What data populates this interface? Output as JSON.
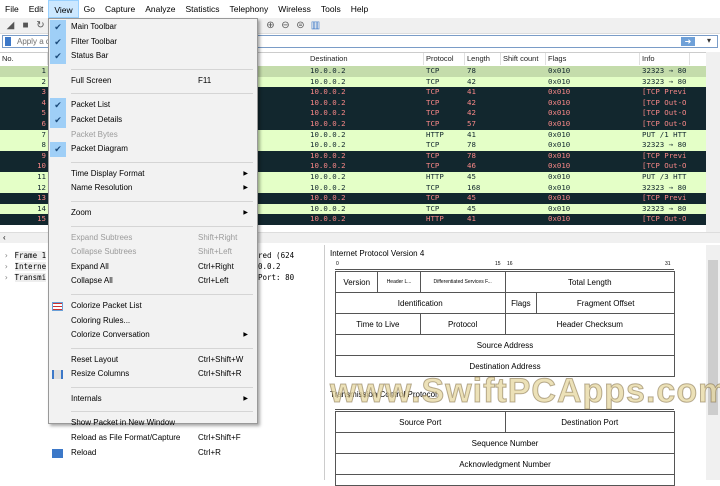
{
  "menubar": [
    "File",
    "Edit",
    "View",
    "Go",
    "Capture",
    "Analyze",
    "Statistics",
    "Telephony",
    "Wireless",
    "Tools",
    "Help"
  ],
  "filter": {
    "placeholder": "Apply a display filter ... <Ctrl-/>",
    "visible_text": "Apply a di"
  },
  "columns": {
    "no": "No.",
    "destination": "Destination",
    "protocol": "Protocol",
    "length": "Length",
    "shift": "Shift count",
    "flags": "Flags",
    "info": "Info"
  },
  "packets": [
    {
      "no": "1",
      "dst": "10.0.0.2",
      "proto": "TCP",
      "len": "78",
      "flags": "0x010",
      "info": "32323 → 80",
      "style": "sel"
    },
    {
      "no": "2",
      "dst": "10.0.0.2",
      "proto": "TCP",
      "len": "42",
      "flags": "0x010",
      "info": "32323 → 80",
      "style": "light"
    },
    {
      "no": "3",
      "dst": "10.0.0.2",
      "proto": "TCP",
      "len": "41",
      "flags": "0x010",
      "info": "[TCP Previ",
      "style": "dark"
    },
    {
      "no": "4",
      "dst": "10.0.0.2",
      "proto": "TCP",
      "len": "42",
      "flags": "0x010",
      "info": "[TCP Out-O",
      "style": "dark"
    },
    {
      "no": "5",
      "dst": "10.0.0.2",
      "proto": "TCP",
      "len": "42",
      "flags": "0x010",
      "info": "[TCP Out-O",
      "style": "dark"
    },
    {
      "no": "6",
      "dst": "10.0.0.2",
      "proto": "TCP",
      "len": "57",
      "flags": "0x010",
      "info": "[TCP Out-O",
      "style": "dark"
    },
    {
      "no": "7",
      "dst": "10.0.0.2",
      "proto": "HTTP",
      "len": "41",
      "flags": "0x010",
      "info": "PUT /1 HTT",
      "style": "light"
    },
    {
      "no": "8",
      "dst": "10.0.0.2",
      "proto": "TCP",
      "len": "78",
      "flags": "0x010",
      "info": "32323 → 80",
      "style": "light"
    },
    {
      "no": "9",
      "dst": "10.0.0.2",
      "proto": "TCP",
      "len": "78",
      "flags": "0x010",
      "info": "[TCP Previ",
      "style": "dark"
    },
    {
      "no": "10",
      "dst": "10.0.0.2",
      "proto": "TCP",
      "len": "46",
      "flags": "0x010",
      "info": "[TCP Out-O",
      "style": "dark"
    },
    {
      "no": "11",
      "dst": "10.0.0.2",
      "proto": "HTTP",
      "len": "45",
      "flags": "0x010",
      "info": "PUT /3 HTT",
      "style": "light"
    },
    {
      "no": "12",
      "dst": "10.0.0.2",
      "proto": "TCP",
      "len": "168",
      "flags": "0x010",
      "info": "32323 → 80",
      "style": "light"
    },
    {
      "no": "13",
      "dst": "10.0.0.2",
      "proto": "TCP",
      "len": "45",
      "flags": "0x010",
      "info": "[TCP Previ",
      "style": "dark"
    },
    {
      "no": "14",
      "dst": "10.0.0.2",
      "proto": "TCP",
      "len": "45",
      "flags": "0x010",
      "info": "32323 → 80",
      "style": "light"
    },
    {
      "no": "15",
      "dst": "10.0.0.2",
      "proto": "HTTP",
      "len": "41",
      "flags": "0x010",
      "info": "[TCP Out-O",
      "style": "dark"
    }
  ],
  "colors": {
    "light": "#e4ffc7",
    "dark": "#12272e",
    "dark_text": "#f78787",
    "selected": "#c4dcab"
  },
  "details": [
    {
      "left": "Frame 1",
      "right": "red (624"
    },
    {
      "left": "Interne",
      "right": "0.0.2"
    },
    {
      "left": "Transmi",
      "right": "Port: 80"
    }
  ],
  "diagram": {
    "ip_title": "Internet Protocol Version 4",
    "tcp_title": "Transmission Control Protocol",
    "ruler": [
      "0",
      "15",
      "16",
      "31"
    ],
    "ip_fields": [
      "Version",
      "Header L...",
      "Differentiated Services F...",
      "Total Length",
      "Identification",
      "Flags",
      "Fragment Offset",
      "Time to Live",
      "Protocol",
      "Header Checksum",
      "Source Address",
      "Destination Address"
    ],
    "tcp_fields": [
      "Source Port",
      "Destination Port",
      "Sequence Number",
      "Acknowledgment Number"
    ]
  },
  "menu": [
    {
      "label": "Main Toolbar",
      "checked": true
    },
    {
      "label": "Filter Toolbar",
      "checked": true
    },
    {
      "label": "Status Bar",
      "checked": true
    },
    {
      "sep": true
    },
    {
      "label": "Full Screen",
      "shortcut": "F11"
    },
    {
      "sep": true
    },
    {
      "label": "Packet List",
      "checked": true
    },
    {
      "label": "Packet Details",
      "checked": true
    },
    {
      "label": "Packet Bytes",
      "disabled": true
    },
    {
      "label": "Packet Diagram",
      "checked": true
    },
    {
      "sep": true
    },
    {
      "label": "Time Display Format",
      "submenu": true
    },
    {
      "label": "Name Resolution",
      "submenu": true
    },
    {
      "sep": true
    },
    {
      "label": "Zoom",
      "submenu": true
    },
    {
      "sep": true
    },
    {
      "label": "Expand Subtrees",
      "shortcut": "Shift+Right",
      "disabled": true
    },
    {
      "label": "Collapse Subtrees",
      "shortcut": "Shift+Left",
      "disabled": true
    },
    {
      "label": "Expand All",
      "shortcut": "Ctrl+Right"
    },
    {
      "label": "Collapse All",
      "shortcut": "Ctrl+Left"
    },
    {
      "sep": true
    },
    {
      "label": "Colorize Packet List",
      "icon": "colorize-icon"
    },
    {
      "label": "Coloring Rules..."
    },
    {
      "label": "Colorize Conversation",
      "submenu": true
    },
    {
      "sep": true
    },
    {
      "label": "Reset Layout",
      "shortcut": "Ctrl+Shift+W"
    },
    {
      "label": "Resize Columns",
      "shortcut": "Ctrl+Shift+R",
      "icon": "resize-columns-icon"
    },
    {
      "sep": true
    },
    {
      "label": "Internals",
      "submenu": true
    },
    {
      "sep": true
    },
    {
      "label": "Show Packet in New Window"
    },
    {
      "label": "Reload as File Format/Capture",
      "shortcut": "Ctrl+Shift+F"
    },
    {
      "label": "Reload",
      "shortcut": "Ctrl+R",
      "icon": "reload-icon"
    }
  ],
  "watermark": "www.SwiftPCApps.com"
}
